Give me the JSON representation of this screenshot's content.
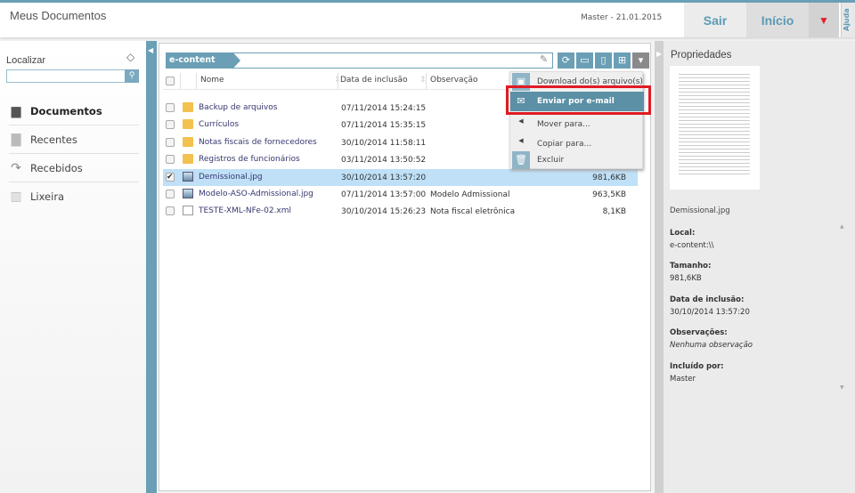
{
  "header": {
    "title": "Meus Documentos",
    "user_date": "Master  -  21.01.2015",
    "logout": "Sair",
    "home": "Início",
    "help": "Ajuda",
    "menu_icon": "triangle-down-icon",
    "accent": "#6a9fb5",
    "menu_color": "#e0202a"
  },
  "sidebar": {
    "search_label": "Localizar",
    "search_value": "",
    "items": [
      {
        "label": "Documentos",
        "icon": "documents-icon",
        "active": true
      },
      {
        "label": "Recentes",
        "icon": "recent-icon"
      },
      {
        "label": "Recebidos",
        "icon": "received-icon"
      },
      {
        "label": "Lixeira",
        "icon": "trash-icon"
      }
    ]
  },
  "main": {
    "breadcrumb": "e-content",
    "columns": [
      "Nome",
      "Data de inclusão",
      "Observação"
    ],
    "rows": [
      {
        "name": "Backup de arquivos",
        "date": "07/11/2014 15:24:15",
        "obs": "",
        "size": "",
        "type": "folder",
        "checked": false
      },
      {
        "name": "Currículos",
        "date": "07/11/2014 15:35:15",
        "obs": "",
        "size": "",
        "type": "folder",
        "checked": false
      },
      {
        "name": "Notas fiscais de fornecedores",
        "date": "30/10/2014 11:58:11",
        "obs": "",
        "size": "",
        "type": "folder",
        "checked": false
      },
      {
        "name": "Registros de funcionários",
        "date": "03/11/2014 13:50:52",
        "obs": "",
        "size": "",
        "type": "folder",
        "checked": false
      },
      {
        "name": "Demissional.jpg",
        "date": "30/10/2014 13:57:20",
        "obs": "",
        "size": "981,6KB",
        "type": "image",
        "checked": true
      },
      {
        "name": "Modelo-ASO-Admissional.jpg",
        "date": "07/11/2014 13:57:00",
        "obs": "Modelo Admissional",
        "size": "963,5KB",
        "type": "image",
        "checked": false
      },
      {
        "name": "TESTE-XML-NFe-02.xml",
        "date": "30/10/2014 15:26:23",
        "obs": "Nota fiscal eletrônica",
        "size": "8,1KB",
        "type": "xml",
        "checked": false
      }
    ],
    "context_menu": [
      "Download do(s) arquivo(s)",
      "Enviar por e-mail",
      "Mover para...",
      "Copiar para...",
      "Excluir"
    ],
    "highlighted_menu_item": "Enviar por e-mail"
  },
  "properties": {
    "title": "Propriedades",
    "file": "Demissional.jpg",
    "fields": [
      {
        "label": "Local:",
        "value": "e-content:\\\\"
      },
      {
        "label": "Tamanho:",
        "value": "981,6KB"
      },
      {
        "label": "Data de inclusão:",
        "value": "30/10/2014 13:57:20"
      },
      {
        "label": "Observações:",
        "value": "Nenhuma observação"
      },
      {
        "label": "Incluído por:",
        "value": "Master"
      }
    ]
  }
}
